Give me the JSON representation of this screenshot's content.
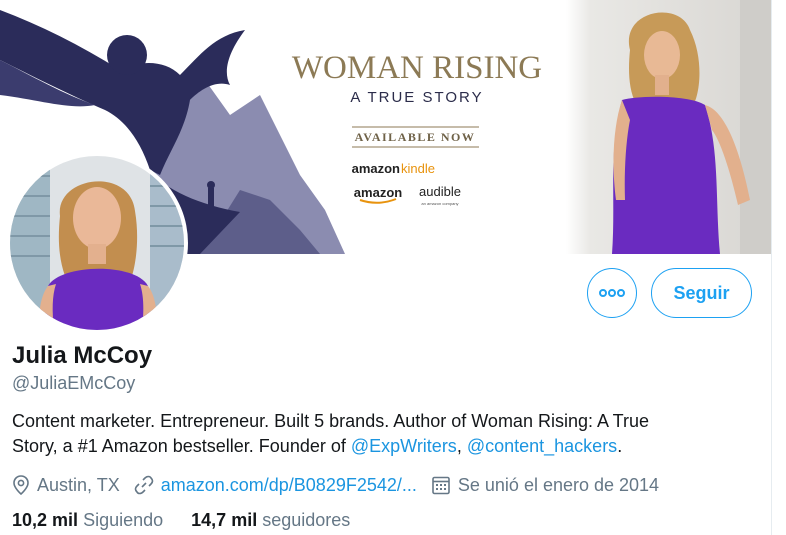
{
  "banner": {
    "title": "WOMAN RISING",
    "subtitle": "A TRUE STORY",
    "available": "AVAILABLE NOW",
    "store_kindle_a": "amazon",
    "store_kindle_b": "kindle",
    "store_amazon": "amazon",
    "store_audible": "audible",
    "store_audible_sub": "an amazon company"
  },
  "profile": {
    "name": "Julia McCoy",
    "handle": "@JuliaEMcCoy",
    "bio_line1": "Content marketer. Entrepreneur. Built 5 brands. Author of Woman Rising: A True",
    "bio_line2_prefix": "Story, a #1 Amazon bestseller. Founder of ",
    "bio_link1": "@ExpWriters",
    "bio_sep": ", ",
    "bio_link2": "@content_hackers",
    "bio_end": ".",
    "location": "Austin, TX",
    "website": "amazon.com/dp/B0829F2542/...",
    "joined": "Se unió el enero de 2014"
  },
  "actions": {
    "follow_label": "Seguir",
    "more_icon": "more-icon"
  },
  "stats": {
    "following_count": "10,2 mil",
    "following_label": "Siguiendo",
    "followers_count": "14,7 mil",
    "followers_label": "seguidores"
  },
  "colors": {
    "accent": "#1da1f2",
    "link": "#1b95e0",
    "muted": "#657786",
    "banner_purple": "#2b2c5a",
    "dress_purple": "#6a2bc0",
    "gold": "#8c7a55"
  }
}
